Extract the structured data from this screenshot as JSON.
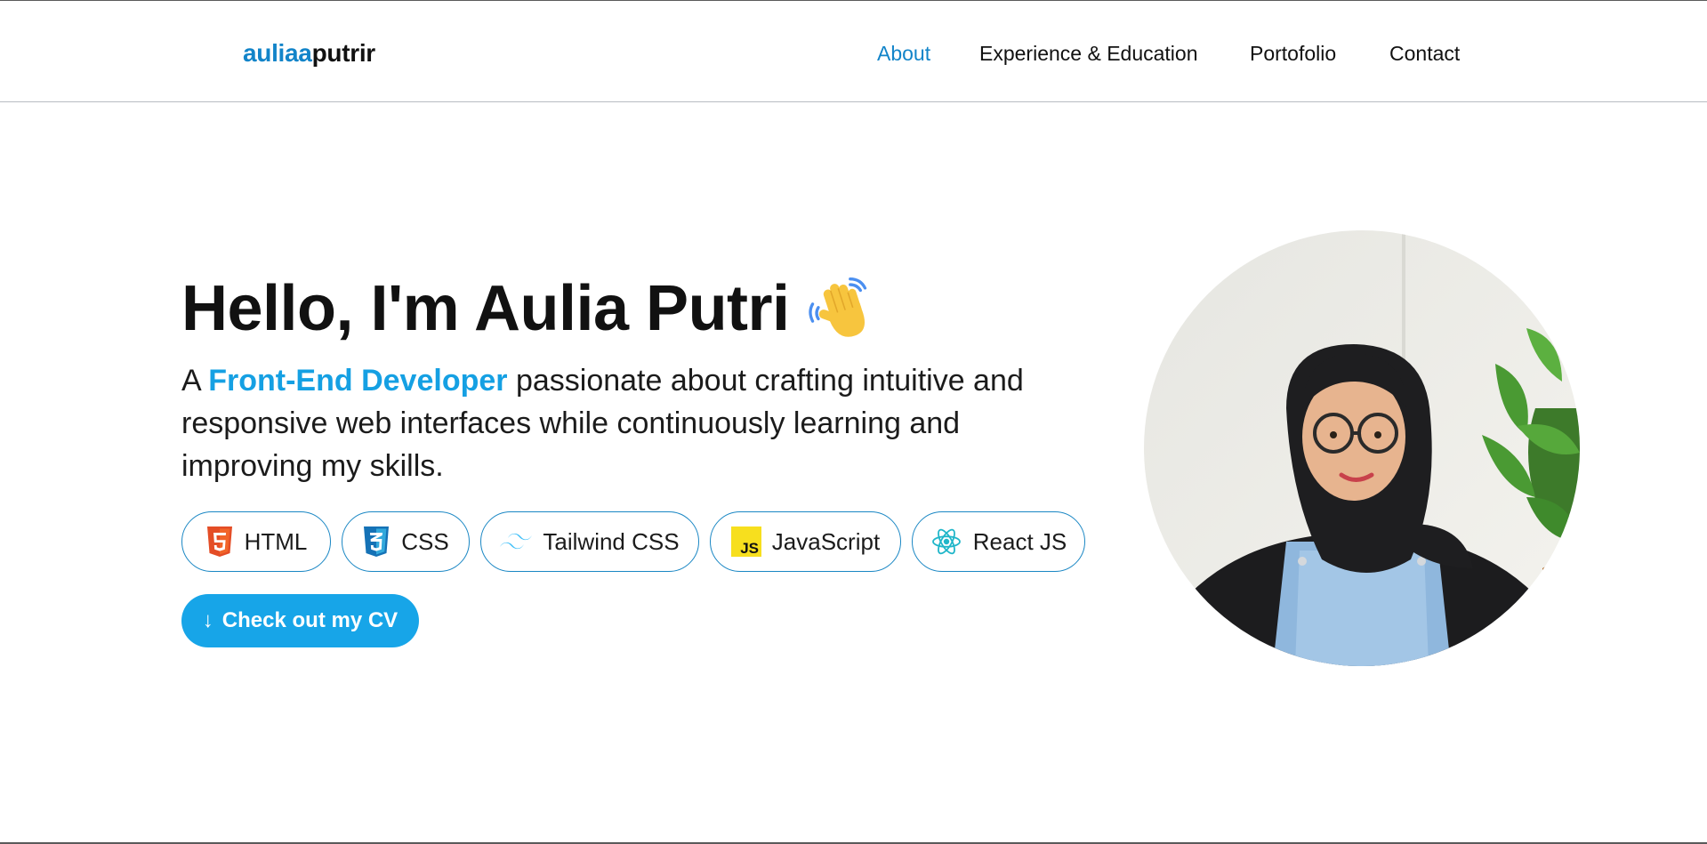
{
  "logo": {
    "part1": "auliaa",
    "part2": "putrir"
  },
  "nav": {
    "items": [
      {
        "label": "About",
        "active": true
      },
      {
        "label": "Experience & Education",
        "active": false
      },
      {
        "label": "Portofolio",
        "active": false
      },
      {
        "label": "Contact",
        "active": false
      }
    ]
  },
  "hero": {
    "title": "Hello, I'm Aulia Putri",
    "title_emoji": "waving-hand-icon",
    "desc_prefix": "A ",
    "desc_highlight": "Front-End Developer",
    "desc_suffix": " passionate about crafting intuitive and responsive web interfaces while continuously learning and improving my skills."
  },
  "skills": [
    {
      "label": "HTML",
      "icon": "html5-icon"
    },
    {
      "label": "CSS",
      "icon": "css3-icon"
    },
    {
      "label": "Tailwind CSS",
      "icon": "tailwind-icon"
    },
    {
      "label": "JavaScript",
      "icon": "javascript-icon"
    },
    {
      "label": "React JS",
      "icon": "react-icon"
    }
  ],
  "cv_button": {
    "arrow": "↓",
    "label": "Check out my CV"
  },
  "profile": {
    "image": "profile-photo"
  },
  "colors": {
    "accent": "#1284c9",
    "highlight": "#15a0e3",
    "button": "#17a5e8",
    "pill_border": "#1a87c4"
  }
}
